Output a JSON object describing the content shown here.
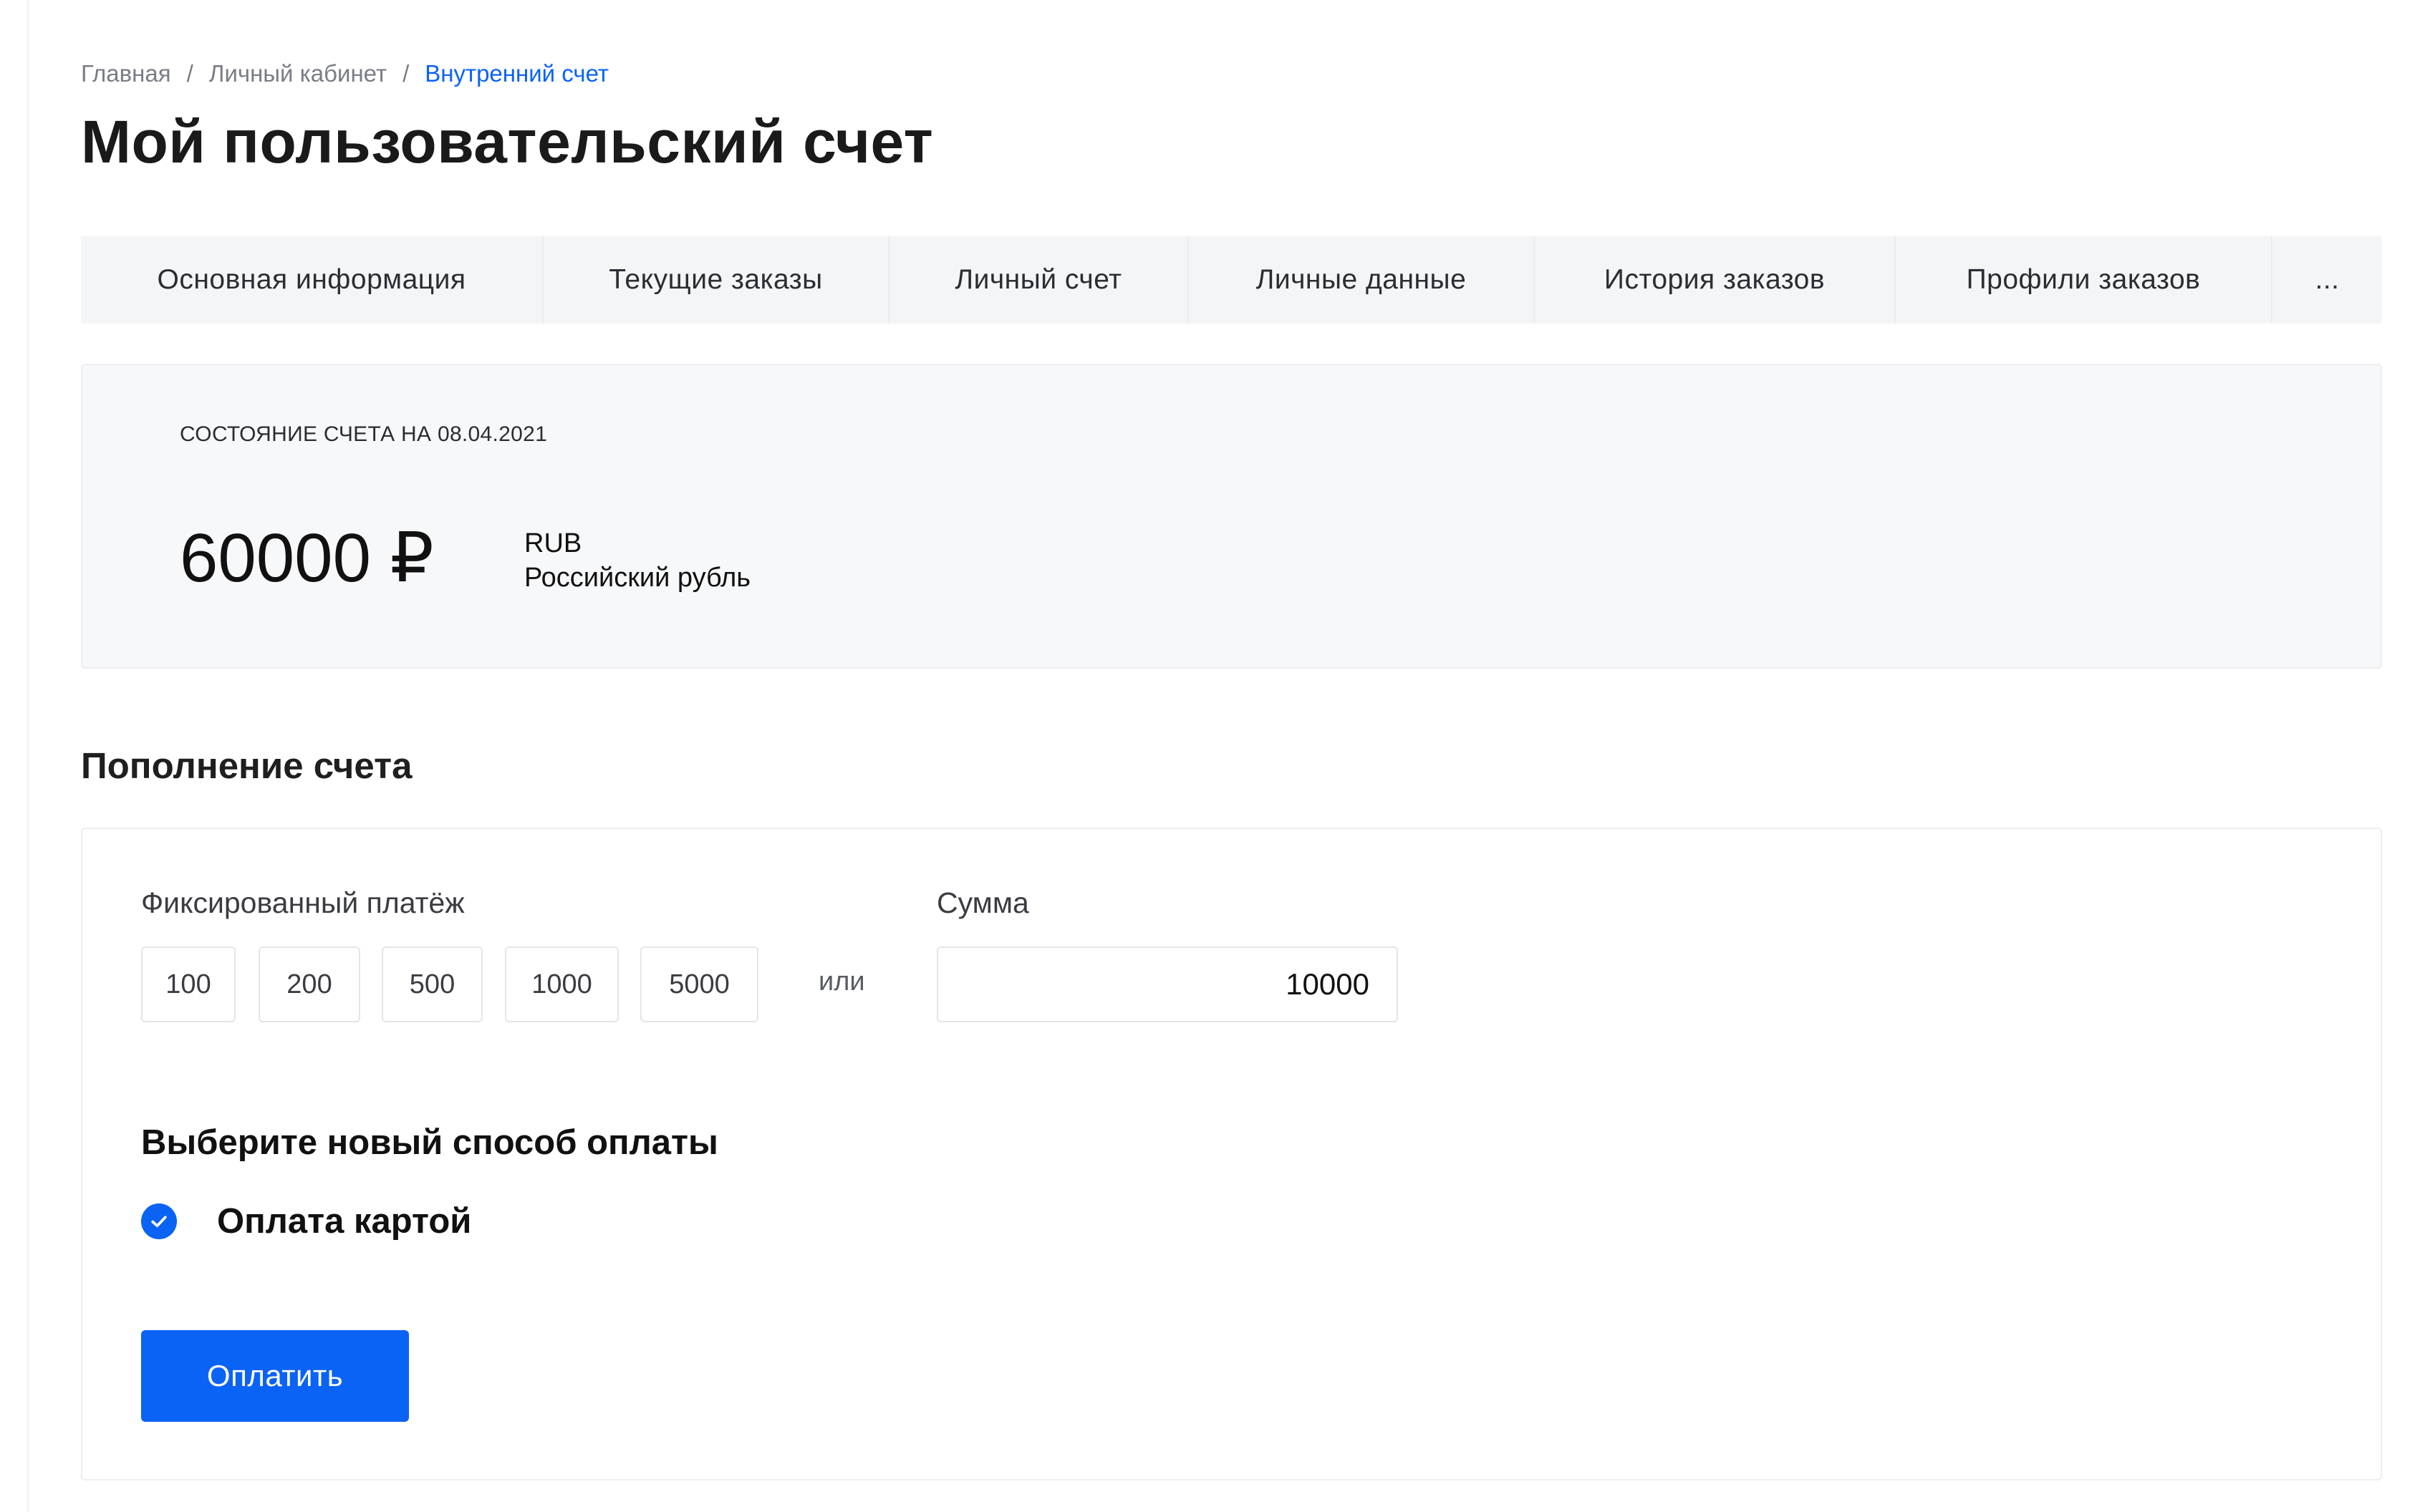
{
  "breadcrumb": {
    "items": [
      "Главная",
      "Личный кабинет",
      "Внутренний счет"
    ],
    "separator": "/"
  },
  "page_title": "Мой пользовательский счет",
  "tabs": [
    {
      "label": "Основная информация"
    },
    {
      "label": "Текущие заказы"
    },
    {
      "label": "Личный счет"
    },
    {
      "label": "Личные данные"
    },
    {
      "label": "История заказов"
    },
    {
      "label": "Профили заказов"
    },
    {
      "label": "..."
    }
  ],
  "balance": {
    "caption": "СОСТОЯНИЕ СЧЕТА НА 08.04.2021",
    "amount": "60000 ₽",
    "currency_code": "RUB",
    "currency_name": "Российский рубль"
  },
  "topup": {
    "heading": "Пополнение счета",
    "fixed_label": "Фиксированный платёж",
    "fixed_amounts": [
      "100",
      "200",
      "500",
      "1000",
      "5000"
    ],
    "or_text": "или",
    "sum_label": "Сумма",
    "sum_value": "10000",
    "method_heading": "Выберите новый способ оплаты",
    "method_option": "Оплата картой",
    "method_checked": true,
    "pay_button": "Оплатить"
  },
  "colors": {
    "accent": "#0b63f6",
    "tab_bg": "#f4f5f7",
    "card_bg": "#f7f8fa"
  },
  "icons": {
    "method_check": "check-circle-icon"
  }
}
